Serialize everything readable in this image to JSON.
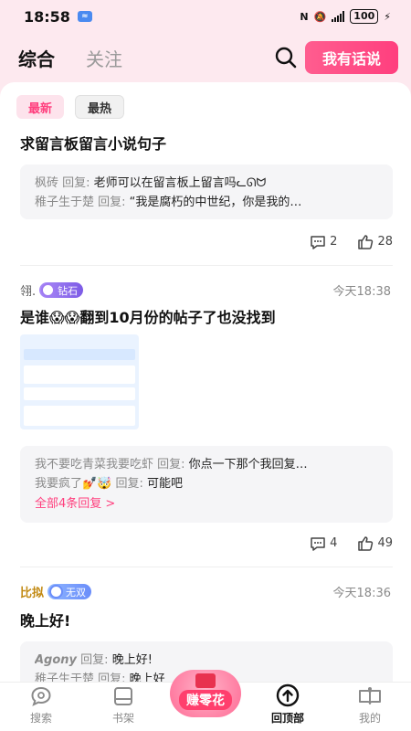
{
  "status": {
    "time": "18:58",
    "battery": "100"
  },
  "top_nav": {
    "tabs": [
      {
        "label": "综合",
        "active": true
      },
      {
        "label": "关注",
        "active": false
      }
    ],
    "speak_button": "我有话说",
    "icons": {
      "search": "search-icon"
    }
  },
  "sort": {
    "options": [
      {
        "label": "最新",
        "active": true
      },
      {
        "label": "最热",
        "active": false
      }
    ]
  },
  "posts": [
    {
      "title": "求留言板留言小说句子",
      "replies": [
        {
          "who": "枫砖 回复:",
          "text": "老师可以在留言板上留言吗ᓚᘏᗢ"
        },
        {
          "who": "稚子生于楚 回复:",
          "text": "“我是腐朽的中世纪，你是我的…"
        }
      ],
      "comments": "2",
      "likes": "28"
    },
    {
      "author": "翎.",
      "badge": "钻石",
      "time": "今天18:38",
      "title": "是谁😱😱翻到10月份的帖子了也没找到",
      "replies": [
        {
          "who": "我不要吃青菜我要吃虾 回复:",
          "text": "你点一下那个我回复…"
        },
        {
          "who": "我要疯了💅🤯 回复:",
          "text": "可能吧"
        }
      ],
      "more_replies": "全部4条回复 >",
      "comments": "4",
      "likes": "49"
    },
    {
      "author": "比拟",
      "badge": "无双",
      "time": "今天18:36",
      "title": "晚上好!",
      "replies": [
        {
          "who": "Agony",
          "who_suffix": " 回复:",
          "text": "晚上好!"
        },
        {
          "who": "稚子生于楚 回复:",
          "text": "晚上好"
        }
      ]
    }
  ],
  "bottom_nav": {
    "items": [
      {
        "label": "搜索",
        "icon": "chat-search-icon"
      },
      {
        "label": "书架",
        "icon": "bookshelf-icon"
      },
      {
        "label": "赚零花",
        "icon": "gift-icon"
      },
      {
        "label": "回顶部",
        "icon": "back-to-top-icon"
      },
      {
        "label": "我的",
        "icon": "profile-book-icon"
      }
    ]
  }
}
